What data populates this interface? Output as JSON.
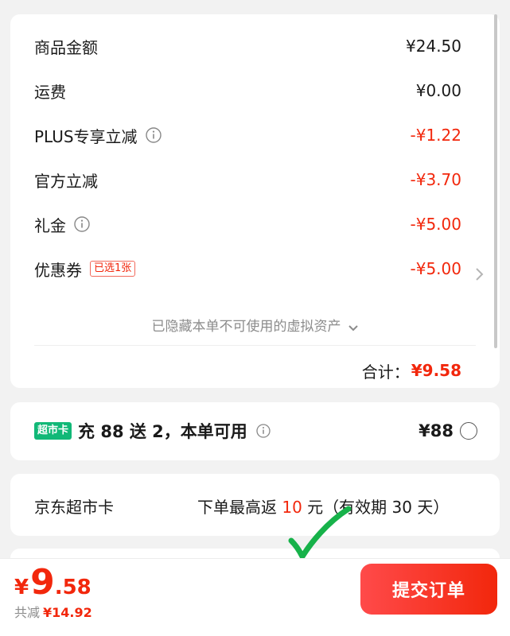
{
  "summary": {
    "goods_amount": {
      "label": "商品金额",
      "value": "¥24.50"
    },
    "shipping": {
      "label": "运费",
      "value": "¥0.00"
    },
    "plus_discount": {
      "label": "PLUS专享立减",
      "value": "-¥1.22"
    },
    "official_discount": {
      "label": "官方立减",
      "value": "-¥3.70"
    },
    "gift_money": {
      "label": "礼金",
      "value": "-¥5.00"
    },
    "coupon": {
      "label": "优惠券",
      "tag": "已选1张",
      "value": "-¥5.00"
    },
    "hidden_assets_text": "已隐藏本单不可使用的虚拟资产",
    "total_label": "合计：",
    "total_value": "¥9.58"
  },
  "supermarket_card_offer": {
    "badge": "超市卡",
    "title": "充 88 送 2，本单可用",
    "price": "¥88"
  },
  "jd_card": {
    "label": "京东超市卡",
    "desc_prefix": "下单最高返 ",
    "desc_amount": "10",
    "desc_suffix": " 元（有效期 30 天）"
  },
  "bottom_bar": {
    "currency": "¥",
    "pay_int": "9",
    "pay_dec": ".58",
    "saved_label": "共减",
    "saved_value": "¥14.92",
    "submit_label": "提交订单"
  },
  "colors": {
    "accent_red": "#f2270c",
    "supercard_green": "#11b877",
    "checkmark_green": "#17b24a"
  },
  "icons": [
    "info-icon",
    "chevron-right-icon",
    "chevron-down-icon",
    "radio-icon",
    "checkmark-icon"
  ]
}
